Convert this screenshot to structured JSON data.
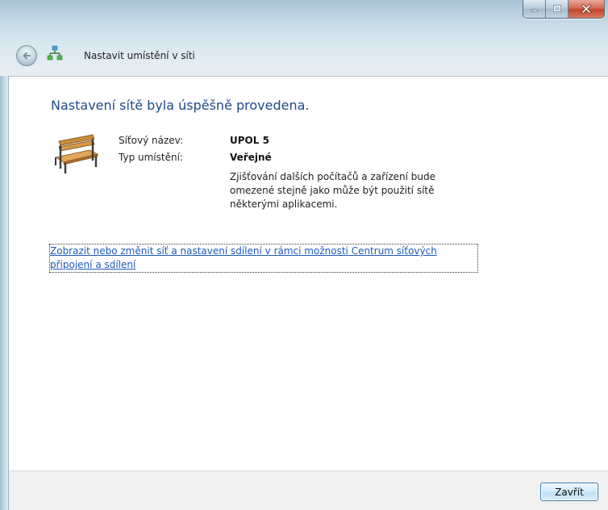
{
  "window": {
    "title": "Nastavit umístění v síti"
  },
  "content": {
    "heading": "Nastavení sítě byla úspěšně provedena.",
    "network_name_label": "Síťový název:",
    "network_name_value": "UPOL 5",
    "location_type_label": "Typ umístění:",
    "location_type_value": "Veřejné",
    "description_lines": [
      "Zjišťování dalších počítačů a zařízení bude",
      "omezené stejně jako může být použití sítě",
      "některými aplikacemi."
    ],
    "link_lines": [
      "Zobrazit nebo změnit síť a nastavení sdílení v rámci možnosti Centrum síťových",
      "připojení a sdílení"
    ]
  },
  "footer": {
    "close_label": "Zavřít"
  },
  "colors": {
    "heading": "#1f4a8a",
    "link": "#1d5ab8"
  },
  "icons": {
    "back": "back-arrow-icon",
    "network": "network-icon",
    "location": "park-bench-icon",
    "minimize": "minimize-icon",
    "maximize": "maximize-icon",
    "close": "close-icon"
  }
}
